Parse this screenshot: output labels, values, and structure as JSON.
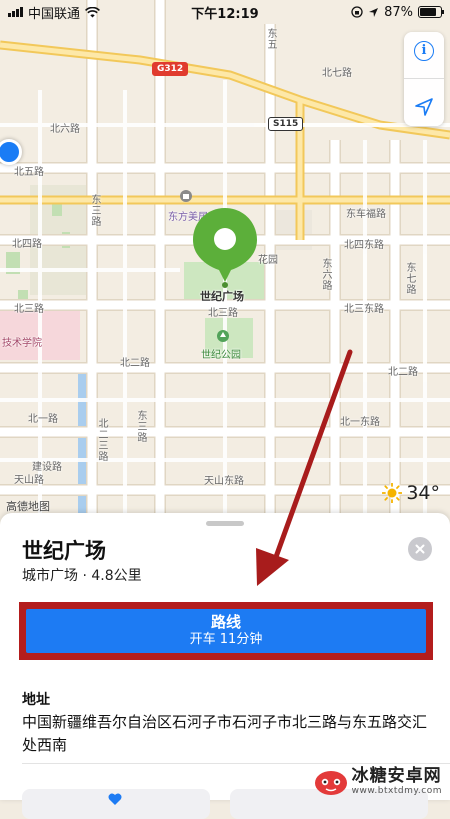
{
  "status_bar": {
    "carrier": "中国联通",
    "time": "下午12:19",
    "battery_percent": "87%",
    "battery_level": 0.87
  },
  "map": {
    "road_labels": {
      "g312": "G312",
      "s115": "S115",
      "bei_qi_lu": "北七路",
      "bei_liu_lu": "北六路",
      "bei_wu_lu": "北五路",
      "bei_si_lu": "北四路",
      "bei_san_lu": "北三路",
      "bei_er_lu": "北二路",
      "bei_er_lu_right": "北二路",
      "bei_yi_lu": "北一路",
      "bei_yi_dong_lu": "北一东路",
      "bei_san_dong_lu": "北三东路",
      "bei_si_dong_lu": "北四东路",
      "dong_che_fu_lu": "东车福路",
      "dong_san_lu": "东三路",
      "dong_liu_lu": "东六路",
      "dong_qi_lu": "东七路",
      "dong_wu_lu": "东五",
      "bei_er_san_lu": "北二三路",
      "jian_she_lu": "建设路",
      "tian_shan_lu": "天山路",
      "tian_shan_dong_lu": "天山东路",
      "dong_san_lu_2": "东三路",
      "bei_san_lu_2": "北三路"
    },
    "poi_labels": {
      "dong_fang_mei": "东方美居",
      "hua_yuan": "花园",
      "shi_ji_guang_chang": "世纪广场",
      "shi_ji_gong_yuan": "世纪公园",
      "ji_shu_xue_yuan": "技术学院",
      "bei_er_san_lu_poi": "北二三路"
    },
    "weather_temp": "34°",
    "attribution": "高德地图"
  },
  "sheet": {
    "title": "世纪广场",
    "subtitle": "城市广场 · 4.8公里",
    "route_button": {
      "label": "路线",
      "sub": "开车 11分钟"
    },
    "address_label": "地址",
    "address": "中国新疆维吾尔自治区石河子市石河子市北三路与东五路交汇处西南"
  },
  "watermark": {
    "name": "冰糖安卓网",
    "url": "www.btxtdmy.com"
  },
  "colors": {
    "accent_blue": "#1d7bf3",
    "pin_green": "#5caf3a",
    "annotation_red": "#b31d1d"
  }
}
